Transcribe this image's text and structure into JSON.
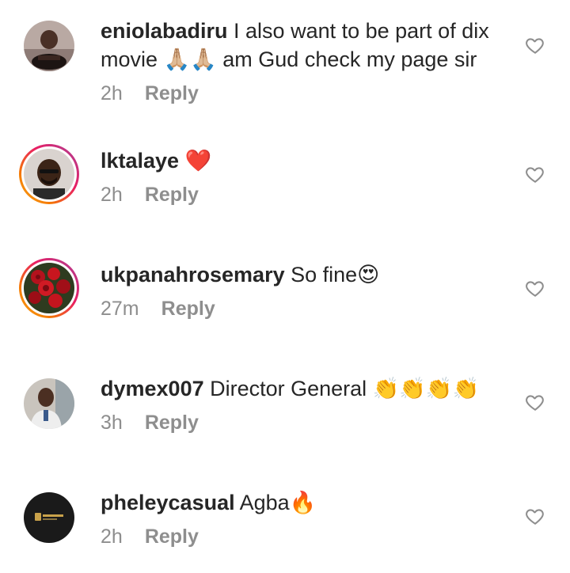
{
  "comments": [
    {
      "username": "eniolabadiru",
      "text_line1": " I also want to be part of dix",
      "text_line2_a": "movie ",
      "text_line2_emoji": "🙏🏼🙏🏼",
      "text_line2_b": " am Gud check my page sir",
      "time": "2h",
      "reply": "Reply",
      "avatar_icon": "profile-photo",
      "has_story_ring": false
    },
    {
      "username": "lktalaye",
      "text": " ",
      "emoji": "❤️",
      "time": "2h",
      "reply": "Reply",
      "avatar_icon": "profile-photo",
      "has_story_ring": true
    },
    {
      "username": "ukpanahrosemary",
      "text": " So fine",
      "emoji": "😍",
      "time": "27m",
      "reply": "Reply",
      "avatar_icon": "profile-photo-roses",
      "has_story_ring": true
    },
    {
      "username": "dymex007",
      "text": " Director General ",
      "emoji": "👏👏👏👏",
      "time": "3h",
      "reply": "Reply",
      "avatar_icon": "profile-photo",
      "has_story_ring": false
    },
    {
      "username": "pheleycasual",
      "text": " Agba",
      "emoji": "🔥",
      "time": "2h",
      "reply": "Reply",
      "avatar_icon": "brand-logo",
      "has_story_ring": false
    }
  ],
  "colors": {
    "username": "#262626",
    "meta": "#8e8e8e",
    "heart_outline": "#8e8e8e",
    "story_ring_start": "#f9a825",
    "story_ring_end": "#c13584"
  },
  "icons": {
    "like": "heart-outline-icon"
  }
}
